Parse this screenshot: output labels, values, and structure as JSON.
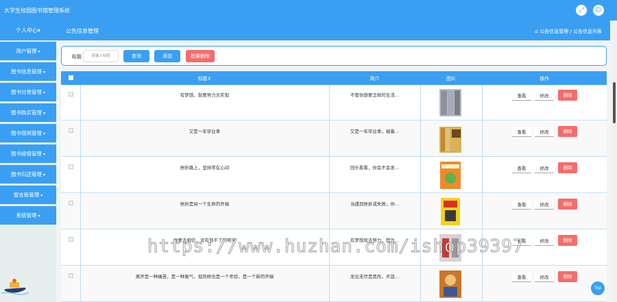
{
  "header": {
    "app_title": "大学生校园图书馆管理系统"
  },
  "sidebar": {
    "head": "个人中心",
    "items": [
      {
        "label": "用户管理"
      },
      {
        "label": "图书信息管理"
      },
      {
        "label": "图书分类管理"
      },
      {
        "label": "图书购买管理"
      },
      {
        "label": "图书借阅管理"
      },
      {
        "label": "图书续借管理"
      },
      {
        "label": "图书归还管理"
      },
      {
        "label": "留言板管理"
      },
      {
        "label": "系统管理"
      }
    ]
  },
  "breadcrumb": {
    "title": "公告信息管理",
    "path": "公告信息管理 / 公告信息列表"
  },
  "search": {
    "label": "标题",
    "placeholder": "请输入标题",
    "query_btn": "查询",
    "add_btn": "添加",
    "batch_delete_btn": "批量删除"
  },
  "table": {
    "columns": [
      "标题",
      "简介",
      "图片",
      "操作"
    ],
    "rows": [
      {
        "title": "有梦想，就要努力去实现",
        "intro": "不管你想要怎样的生活..."
      },
      {
        "title": "又是一年毕业季",
        "intro": "又是一年毕业季，褪着..."
      },
      {
        "title": "挫折路上，坚持常在心间",
        "intro": "回头看看，你会不会发..."
      },
      {
        "title": "挫折是另一个生命的开端",
        "intro": "当遇到挫折或失败，你..."
      },
      {
        "title": "你要去相信，没有到不了的明天",
        "intro": "有梦想就去努力，因为..."
      },
      {
        "title": "离开是一种痛苦，是一种勇气，但同样也是一个考验，是一个新的开端",
        "intro": "无论无尽是黑彤，天涯..."
      }
    ],
    "ops": {
      "view": "查看",
      "edit": "修改",
      "delete": "删除"
    }
  },
  "top_button": "Top",
  "watermark": "https://www.huzhan.com/ishop39397",
  "colors": {
    "primary": "#3a9ff3",
    "danger": "#f56c6c"
  }
}
